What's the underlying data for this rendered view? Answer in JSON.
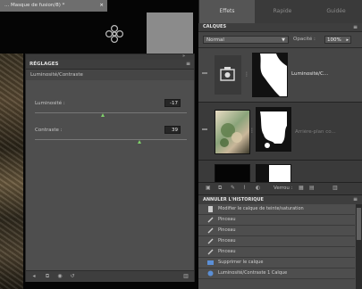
{
  "document": {
    "tab_title": "... Masque de fusion/8) *",
    "tab_close": "×"
  },
  "adjustments_panel": {
    "title": "RÉGLAGES",
    "menu_glyph": "≡",
    "collapse_glyph": "»",
    "subtitle": "Luminosité/Contraste",
    "fields": [
      {
        "label": "Luminosité :",
        "value": "-17",
        "fraction": 0.45
      },
      {
        "label": "Contraste :",
        "value": "39",
        "fraction": 0.69
      }
    ]
  },
  "top_tabs": [
    {
      "label": "Effets"
    },
    {
      "label": "Rapide"
    },
    {
      "label": "Guidée"
    }
  ],
  "layers_panel": {
    "title": "CALQUES",
    "menu_glyph": "≡",
    "blend_mode": "Normal",
    "opacity_label": "Opacité :",
    "opacity_value": "100%",
    "layers": [
      {
        "name": "Luminosité/C..."
      },
      {
        "name": "Arrière-plan co..."
      }
    ],
    "footer": {
      "lock_label": "Verrou :"
    }
  },
  "history_panel": {
    "title": "ANNULER L'HISTORIQUE",
    "menu_glyph": "≡",
    "items": [
      {
        "label": "Modifier le calque de teinte/saturation"
      },
      {
        "label": "Pinceau"
      },
      {
        "label": "Pinceau"
      },
      {
        "label": "Pinceau"
      },
      {
        "label": "Pinceau"
      },
      {
        "label": "Supprimer le calque"
      },
      {
        "label": "Luminosité/Contraste 1 Calque"
      }
    ]
  },
  "colors": {
    "accent_slider": "#7fd06a",
    "panel_bg": "#4e4e4e",
    "dark_bg": "#0b0b0b"
  }
}
